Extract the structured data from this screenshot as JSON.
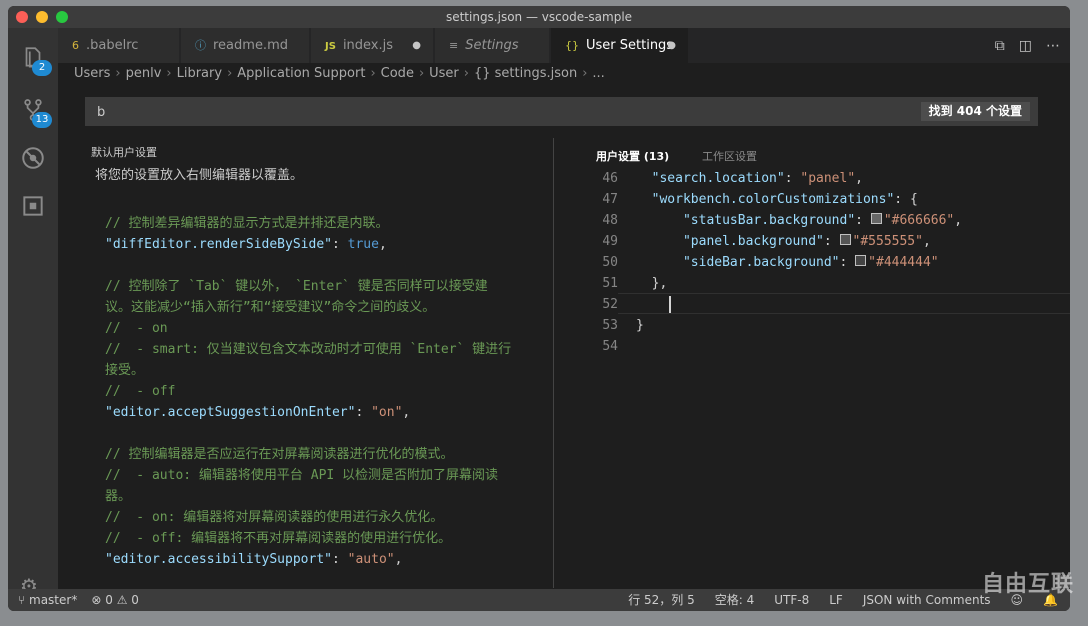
{
  "window": {
    "title": "settings.json — vscode-sample"
  },
  "activity": {
    "explorer_badge": "2",
    "scm_badge": "13"
  },
  "tabs": [
    {
      "label": ".babelrc",
      "icon": "6"
    },
    {
      "label": "readme.md",
      "icon": "ⓘ"
    },
    {
      "label": "index.js",
      "icon": "JS"
    },
    {
      "label": "Settings",
      "icon": "≡"
    },
    {
      "label": "User Settings",
      "icon": "{}"
    }
  ],
  "breadcrumb": [
    "Users",
    "penlv",
    "Library",
    "Application Support",
    "Code",
    "User",
    "{} settings.json",
    "..."
  ],
  "search": {
    "value": "b",
    "count": "找到 404 个设置"
  },
  "left": {
    "title": "默认用户设置",
    "hint": "将您的设置放入右侧编辑器以覆盖。",
    "lines": [
      {
        "t": "cm",
        "s": "// 控制差异编辑器的显示方式是并排还是内联。"
      },
      {
        "t": "kv",
        "k": "\"diffEditor.renderSideBySide\"",
        "v": "true",
        "vt": "kw"
      },
      {
        "t": "blank",
        "s": ""
      },
      {
        "t": "cm",
        "s": "// 控制除了 `Tab` 键以外， `Enter` 键是否同样可以接受建"
      },
      {
        "t": "cm",
        "s": "议。这能减少“插入新行”和“接受建议”命令之间的歧义。"
      },
      {
        "t": "cm",
        "s": "//  - on"
      },
      {
        "t": "cm",
        "s": "//  - smart: 仅当建议包含文本改动时才可使用 `Enter` 键进行"
      },
      {
        "t": "cm",
        "s": "接受。"
      },
      {
        "t": "cm",
        "s": "//  - off"
      },
      {
        "t": "kv",
        "k": "\"editor.acceptSuggestionOnEnter\"",
        "v": "\"on\"",
        "vt": "str"
      },
      {
        "t": "blank",
        "s": ""
      },
      {
        "t": "cm",
        "s": "// 控制编辑器是否应运行在对屏幕阅读器进行优化的模式。"
      },
      {
        "t": "cm",
        "s": "//  - auto: 编辑器将使用平台 API 以检测是否附加了屏幕阅读"
      },
      {
        "t": "cm",
        "s": "器。"
      },
      {
        "t": "cm",
        "s": "//  - on: 编辑器将对屏幕阅读器的使用进行永久优化。"
      },
      {
        "t": "cm",
        "s": "//  - off: 编辑器将不再对屏幕阅读器的使用进行优化。"
      },
      {
        "t": "kv",
        "k": "\"editor.accessibilitySupport\"",
        "v": "\"auto\"",
        "vt": "str"
      }
    ]
  },
  "right": {
    "tab_user": "用户设置 (13)",
    "tab_workspace": "工作区设置",
    "line_numbers": [
      "46",
      "47",
      "48",
      "49",
      "50",
      "51",
      "52",
      "53",
      "54"
    ],
    "lines": [
      {
        "indent": "  ",
        "k": "\"search.location\"",
        "sep": ": ",
        "v": "\"panel\"",
        "end": ","
      },
      {
        "indent": "  ",
        "k": "\"workbench.colorCustomizations\"",
        "sep": ": ",
        "v": "",
        "end": "{"
      },
      {
        "indent": "      ",
        "k": "\"statusBar.background\"",
        "sep": ": ",
        "v": "\"#666666\"",
        "end": ",",
        "swatch": "#666666"
      },
      {
        "indent": "      ",
        "k": "\"panel.background\"",
        "sep": ": ",
        "v": "\"#555555\"",
        "end": ",",
        "swatch": "#555555"
      },
      {
        "indent": "      ",
        "k": "\"sideBar.background\"",
        "sep": ": ",
        "v": "\"#444444\"",
        "end": "",
        "swatch": "#444444"
      },
      {
        "indent": "  ",
        "k": "",
        "sep": "",
        "v": "",
        "end": "},"
      },
      {
        "indent": "",
        "k": "",
        "sep": "",
        "v": "",
        "end": ""
      },
      {
        "indent": "",
        "k": "",
        "sep": "",
        "v": "",
        "end": "}"
      },
      {
        "indent": "",
        "k": "",
        "sep": "",
        "v": "",
        "end": ""
      }
    ]
  },
  "status": {
    "branch": "master*",
    "errors": "0",
    "warnings": "0",
    "position": "行 52，列 5",
    "spaces": "空格: 4",
    "encoding": "UTF-8",
    "eol": "LF",
    "language": "JSON with Comments"
  },
  "watermark": "自由互联"
}
